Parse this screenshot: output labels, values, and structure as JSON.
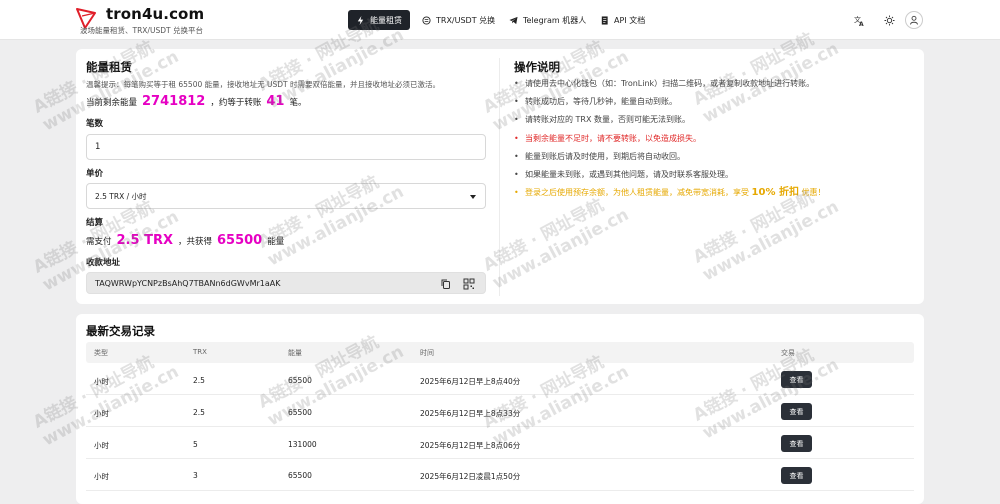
{
  "brand": {
    "title": "tron4u.com",
    "subtitle": "波场能量租赁、TRX/USDT 兑换平台",
    "logo_color": "#e01f2a"
  },
  "nav": [
    {
      "label": "能量租赁",
      "icon": "bolt-icon",
      "active": true
    },
    {
      "label": "TRX/USDT 兑换",
      "icon": "exchange-icon",
      "active": false
    },
    {
      "label": "Telegram 机器人",
      "icon": "telegram-icon",
      "active": false
    },
    {
      "label": "API 文档",
      "icon": "document-icon",
      "active": false
    }
  ],
  "toolbar": {
    "language_icon": "translate-icon",
    "theme_icon": "sun-icon",
    "user_icon": "user-icon"
  },
  "rent": {
    "title": "能量租赁",
    "tip": "温馨提示：每笔购买等于租 65500 能量，接收地址无 USDT 时需要双倍能量，并且接收地址必须已激活。",
    "remaining_prefix": "当前剩余能量",
    "remaining_value": "2741812",
    "remaining_mid": "，约等于转账",
    "remaining_count": "41",
    "remaining_suffix": "笔。",
    "count_label": "笔数",
    "count_value": "1",
    "price_label": "单价",
    "price_value": "2.5 TRX / 小时",
    "settle_label": "结算",
    "pay_prefix": "需支付",
    "pay_value": "2.5 TRX",
    "pay_mid": "，共获得",
    "pay_energy": "65500",
    "pay_suffix": "能量",
    "address_label": "收款地址",
    "address_value": "TAQWRWpYCNPzBsAhQ7TBANn6dGWvMr1aAK"
  },
  "instructions": {
    "title": "操作说明",
    "items": [
      "请使用去中心化钱包（如：TronLink）扫描二维码，或者复制收款地址进行转账。",
      "转账成功后，等待几秒钟，能量自动到账。",
      "请转账对应的 TRX 数量，否则可能无法到账。",
      "当剩余能量不足时，请不要转账，以免造成损失。",
      "能量到账后请及时使用，到期后将自动收回。",
      "如果能量未到账，或遇到其他问题，请及时联系客服处理。"
    ],
    "promo_prefix": "登录之后使用预存余额，为他人租赁能量，减免带宽消耗，享受",
    "promo_pct": "10% 折扣",
    "promo_suffix": "优惠！"
  },
  "records": {
    "title": "最新交易记录",
    "columns": [
      "类型",
      "TRX",
      "能量",
      "时间",
      "交易"
    ],
    "view_label": "查看",
    "rows": [
      {
        "type": "小时",
        "trx": "2.5",
        "energy": "65500",
        "time": "2025年6月12日早上8点40分"
      },
      {
        "type": "小时",
        "trx": "2.5",
        "energy": "65500",
        "time": "2025年6月12日早上8点33分"
      },
      {
        "type": "小时",
        "trx": "5",
        "energy": "131000",
        "time": "2025年6月12日早上8点06分"
      },
      {
        "type": "小时",
        "trx": "3",
        "energy": "65500",
        "time": "2025年6月12日凌晨1点50分"
      }
    ]
  },
  "watermark": {
    "line1": "A链接 · 网址导航",
    "line2": "www.alianjie.cn"
  },
  "colors": {
    "accent_magenta": "#e600c3",
    "warning_red": "#e02a2a",
    "promo_amber": "#e6a800",
    "dark_button": "#2b3038"
  }
}
